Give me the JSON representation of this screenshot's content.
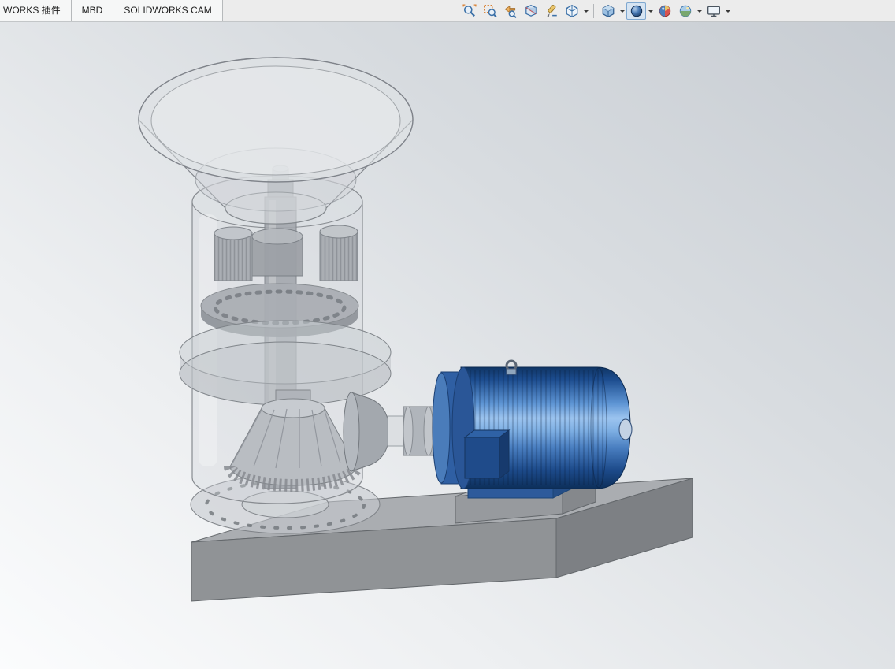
{
  "app": {
    "name": "SOLIDWORKS"
  },
  "command_tabs": {
    "items": [
      {
        "label": "WORKS 插件"
      },
      {
        "label": "MBD"
      },
      {
        "label": "SOLIDWORKS CAM"
      }
    ]
  },
  "heads_up_toolbar": {
    "items": [
      {
        "name": "zoom-to-fit",
        "has_dropdown": false
      },
      {
        "name": "zoom-to-area",
        "has_dropdown": false
      },
      {
        "name": "previous-view",
        "has_dropdown": false
      },
      {
        "name": "section-view",
        "has_dropdown": false
      },
      {
        "name": "dynamic-annotation-views",
        "has_dropdown": false
      },
      {
        "name": "view-orientation",
        "has_dropdown": true
      },
      {
        "name": "display-style",
        "has_dropdown": true
      },
      {
        "name": "hide-show-items",
        "has_dropdown": true,
        "active": true
      },
      {
        "name": "edit-appearance",
        "has_dropdown": false
      },
      {
        "name": "apply-scene",
        "has_dropdown": true
      },
      {
        "name": "view-settings",
        "has_dropdown": true
      }
    ]
  },
  "viewport": {
    "background_top": "#c7ccd2",
    "background_bottom": "#fbfcfd",
    "model": {
      "name": "vertical-mill-assembly",
      "parts": [
        {
          "name": "hopper-funnel",
          "appearance": "transparent-gray",
          "color": "#d6d9dd"
        },
        {
          "name": "gear-housing-cylinder",
          "appearance": "transparent-gray",
          "color": "#d0d4d9"
        },
        {
          "name": "spur-gear-pair",
          "color": "#a6aab0"
        },
        {
          "name": "perforated-disc",
          "color": "#a9adb3"
        },
        {
          "name": "support-flange-discs",
          "color": "#c6cbd0"
        },
        {
          "name": "bevel-gear",
          "color": "#b9bdc2"
        },
        {
          "name": "drive-shaft",
          "color": "#a4a8ae"
        },
        {
          "name": "shaft-coupling",
          "color": "#b0b5bb"
        },
        {
          "name": "electric-motor",
          "color": "#2f5fa3"
        },
        {
          "name": "motor-terminal-box",
          "color": "#1f4b8a"
        },
        {
          "name": "motor-pedestal",
          "color": "#9a9ea3"
        },
        {
          "name": "base-plate",
          "color": "#9ea2a6"
        }
      ]
    }
  }
}
